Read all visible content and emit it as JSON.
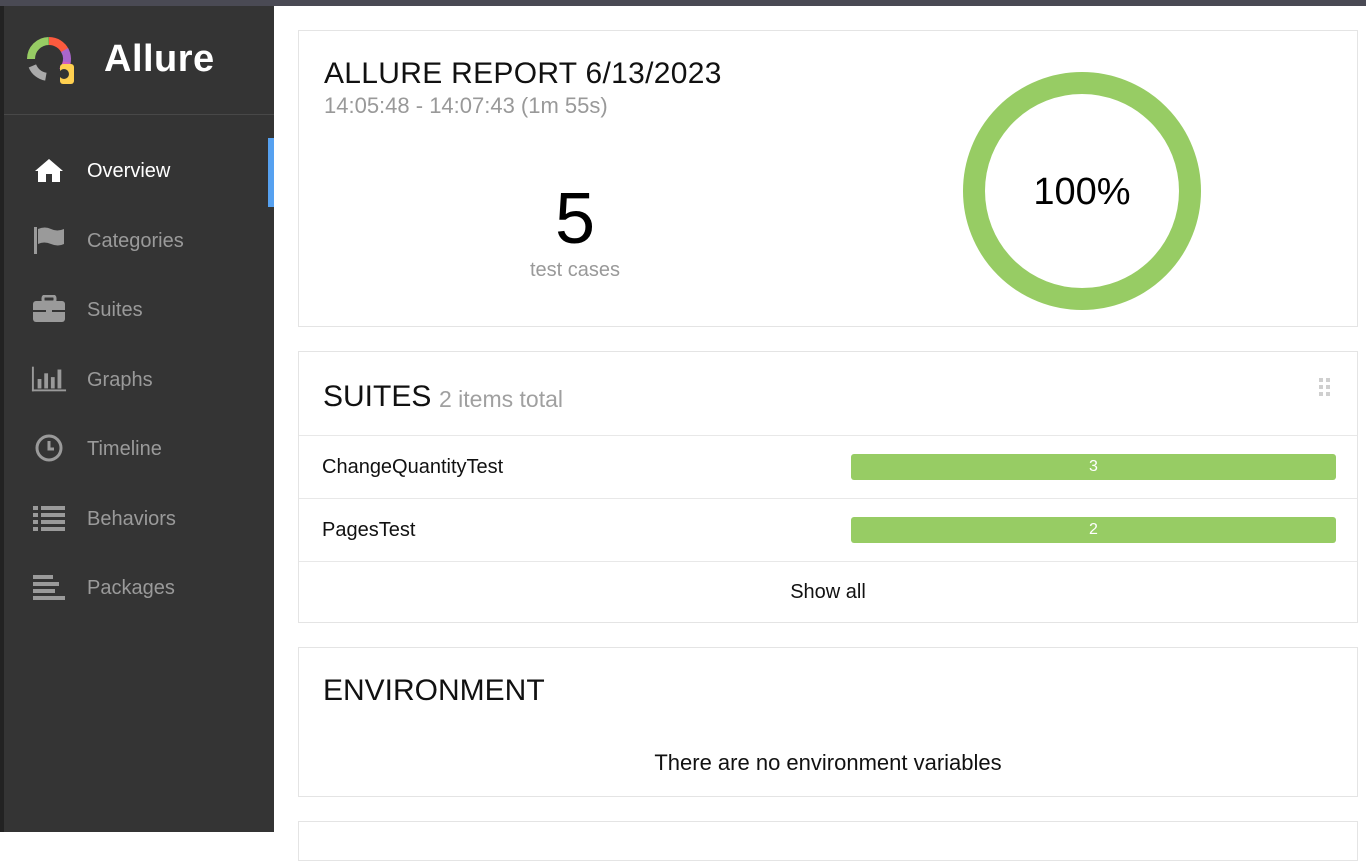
{
  "app": {
    "name": "Allure"
  },
  "sidebar": {
    "items": [
      {
        "label": "Overview",
        "icon": "home-icon",
        "active": true
      },
      {
        "label": "Categories",
        "icon": "flag-icon",
        "active": false
      },
      {
        "label": "Suites",
        "icon": "briefcase-icon",
        "active": false
      },
      {
        "label": "Graphs",
        "icon": "bar-chart-icon",
        "active": false
      },
      {
        "label": "Timeline",
        "icon": "clock-icon",
        "active": false
      },
      {
        "label": "Behaviors",
        "icon": "list-icon",
        "active": false
      },
      {
        "label": "Packages",
        "icon": "align-left-icon",
        "active": false
      }
    ]
  },
  "summary": {
    "title": "ALLURE REPORT 6/13/2023",
    "time": "14:05:48 - 14:07:43 (1m 55s)",
    "count": "5",
    "count_label": "test cases",
    "success_rate": "100%"
  },
  "suites": {
    "title": "SUITES",
    "subtitle": "2 items total",
    "rows": [
      {
        "name": "ChangeQuantityTest",
        "count": "3"
      },
      {
        "name": "PagesTest",
        "count": "2"
      }
    ],
    "show_all": "Show all"
  },
  "environment": {
    "title": "ENVIRONMENT",
    "message": "There are no environment variables"
  },
  "colors": {
    "passed": "#97cc64",
    "sidebar_bg": "#343434",
    "active_indicator": "#56a1f0"
  }
}
